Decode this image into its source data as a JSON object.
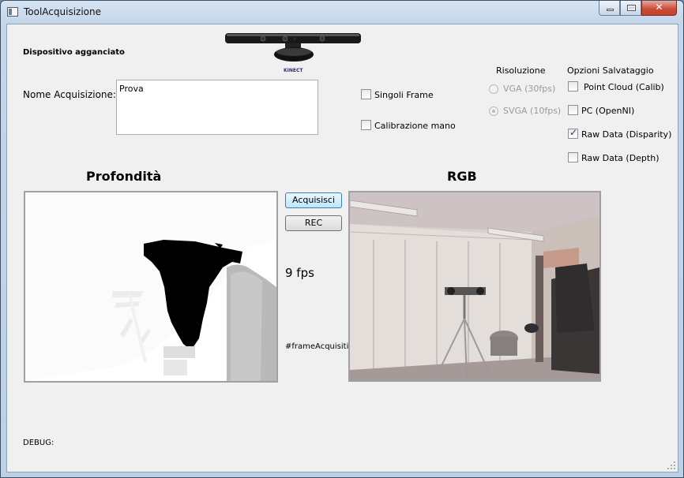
{
  "window": {
    "title": "ToolAcquisizione"
  },
  "header": {
    "device_label": "Dispositivo agganciato",
    "kinect_brand": "KINECT"
  },
  "acquisition": {
    "name_label": "Nome Acquisizione:",
    "name_value": "Prova"
  },
  "options": {
    "single_frame_label": "Singoli Frame",
    "single_frame_checked": false,
    "hand_calibration_label": "Calibrazione mano",
    "hand_calibration_checked": false
  },
  "resolution": {
    "title": "Risoluzione",
    "options": [
      {
        "label": "VGA (30fps)",
        "selected": false
      },
      {
        "label": "SVGA (10fps)",
        "selected": true
      }
    ]
  },
  "save_options": {
    "title": "Opzioni Salvataggio",
    "items": [
      {
        "label": "Point Cloud (Calib)",
        "checked": false
      },
      {
        "label": "PC (OpenNI)",
        "checked": false
      },
      {
        "label": "Raw Data (Disparity)",
        "checked": true
      },
      {
        "label": "Raw Data (Depth)",
        "checked": false
      }
    ]
  },
  "depth_view": {
    "title": "Profondità"
  },
  "rgb_view": {
    "title": "RGB"
  },
  "controls": {
    "acquire_label": "Acquisisci",
    "rec_label": "REC",
    "fps_text": "9 fps",
    "frame_counter_label": "#frameAcquisiti"
  },
  "debug": {
    "label": "DEBUG:"
  }
}
